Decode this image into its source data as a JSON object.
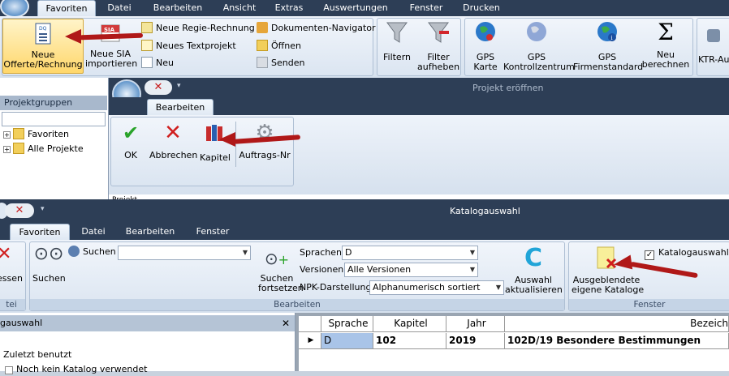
{
  "top": {
    "tabs": [
      "Favoriten",
      "Datei",
      "Bearbeiten",
      "Ansicht",
      "Extras",
      "Auswertungen",
      "Fenster",
      "Drucken"
    ],
    "buttons": {
      "neue_offerte": "Neue\nOfferte/Rechnung",
      "neue_sia": "Neue SIA\nimportieren",
      "neue_regie": "Neue Regie-Rechnung",
      "neues_text": "Neues Textprojekt",
      "neu": "Neu",
      "doku_nav": "Dokumenten-Navigator",
      "oeffnen": "Öffnen",
      "senden": "Senden",
      "filtern": "Filtern",
      "filter_aufheben": "Filter\naufheben",
      "gps_karte": "GPS\nKarte",
      "gps_kontroll": "GPS\nKontrollzentrum",
      "gps_firmen": "GPS\nFirmenstandard",
      "neu_berechnen": "Neu\nberechnen",
      "ktr": "KTR-Au"
    }
  },
  "left_panel": {
    "header": "Projektgruppen",
    "items": [
      "Favoriten",
      "Alle Projekte"
    ]
  },
  "projekt_window": {
    "title": "Projekt eröffnen",
    "tab": "Bearbeiten",
    "buttons": {
      "ok": "OK",
      "abbrechen": "Abbrechen",
      "kapitel": "Kapitel",
      "auftrags": "Auftrags-Nr"
    },
    "partial_text": "Projekt"
  },
  "katalog_window": {
    "title": "Katalogauswahl",
    "tabs": [
      "Favoriten",
      "Datei",
      "Bearbeiten",
      "Fenster"
    ],
    "buttons": {
      "essen": "essen",
      "suchen_big": "Suchen",
      "suchen_label": "Suchen",
      "suchen_fortsetzen": "Suchen\nfortsetzen",
      "auswahl_aktualisieren": "Auswahl\naktualisieren",
      "ausgeblendete": "Ausgeblendete\neigene Kataloge",
      "katalogauswahl_check": "Katalogauswahl"
    },
    "fields": {
      "sprachen_label": "Sprachen",
      "sprachen_value": "D",
      "versionen_label": "Versionen",
      "versionen_value": "Alle Versionen",
      "npk_label": "NPK-Darstellung",
      "npk_value": "Alphanumerisch sortiert",
      "suchen_value": ""
    },
    "group_labels": {
      "tei": "tei",
      "bearbeiten": "Bearbeiten",
      "fenster": "Fenster"
    },
    "side_panel": {
      "title": "gauswahl",
      "item1": "Zuletzt benutzt",
      "item2": "Noch kein Katalog verwendet"
    },
    "table": {
      "headers": [
        "Sprache",
        "Kapitel",
        "Jahr",
        "Bezeich"
      ],
      "rows": [
        [
          "D",
          "102",
          "2019",
          "102D/19 Besondere Bestimmungen"
        ]
      ]
    }
  },
  "colors": {
    "arrow": "#b01818",
    "tabbar": "#2d3e56"
  }
}
